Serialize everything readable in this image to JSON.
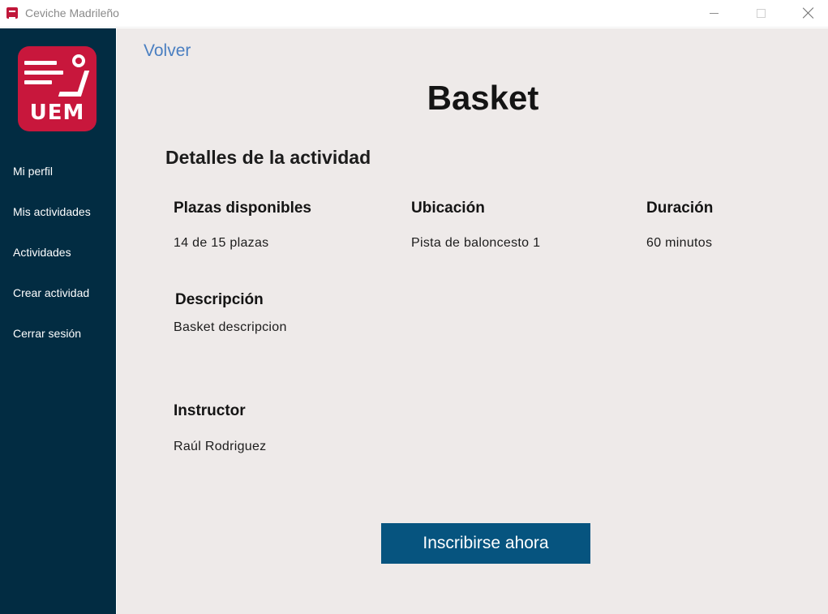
{
  "window": {
    "title": "Ceviche Madrileño"
  },
  "sidebar": {
    "logo_text": "UEM",
    "items": [
      {
        "label": "Mi perfil"
      },
      {
        "label": "Mis actividades"
      },
      {
        "label": "Actividades"
      },
      {
        "label": "Crear actividad"
      },
      {
        "label": "Cerrar sesión"
      }
    ]
  },
  "main": {
    "back_label": "Volver",
    "title": "Basket",
    "section_title": "Detalles de la actividad",
    "fields": {
      "plazas": {
        "label": "Plazas disponibles",
        "value": "14 de 15 plazas"
      },
      "ubicacion": {
        "label": "Ubicación",
        "value": "Pista de baloncesto 1"
      },
      "duracion": {
        "label": "Duración",
        "value": "60 minutos"
      },
      "descripcion": {
        "label": "Descripción",
        "value": "Basket descripcion"
      },
      "instructor": {
        "label": "Instructor",
        "value": "Raúl Rodriguez"
      }
    },
    "cta_label": "Inscribirse ahora"
  },
  "colors": {
    "sidebar_bg": "#022c42",
    "main_bg": "#eeeae9",
    "accent_button": "#06547f",
    "link": "#4a7fc1",
    "brand_red": "#c8173c"
  },
  "icons": {
    "app": "uem-app-icon",
    "minimize": "minimize-icon",
    "maximize": "maximize-icon",
    "close": "close-icon"
  }
}
